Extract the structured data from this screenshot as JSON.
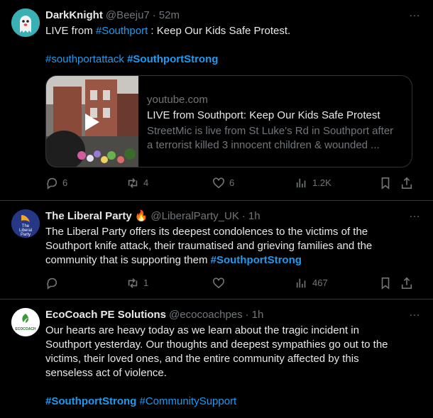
{
  "posts": [
    {
      "name": "DarkKnight",
      "handle": "@Beeju7",
      "dot": "·",
      "time": "52m",
      "text_pre": "LIVE from ",
      "text_link": "#Southport",
      "text_post": " : Keep Our Kids Safe Protest.",
      "hashtag1": "#southportattack",
      "hashtag2": "#SouthportStrong",
      "card": {
        "domain": "youtube.com",
        "title": "LIVE from Southport: Keep Our Kids Safe Protest",
        "desc_line1": "StreetMic is live from St Luke's Rd in Southport after",
        "desc_line2": "a terrorist killed 3 innocent children & wounded ..."
      },
      "replies": "6",
      "reposts": "4",
      "likes": "6",
      "views": "1.2K"
    },
    {
      "name": "The Liberal Party",
      "emoji": "🔥",
      "handle": "@LiberalParty_UK",
      "dot": "·",
      "time": "1h",
      "avatar_text": "The Liberal Party",
      "line1": "The Liberal Party offers its deepest condolences to the victims of the",
      "line2": "Southport knife attack, their traumatised and grieving families and the",
      "line3_pre": "community that is supporting them ",
      "line3_tag": "#SouthportStrong",
      "replies": "",
      "reposts": "1",
      "likes": "",
      "views": "467"
    },
    {
      "name": "EcoCoach PE Solutions",
      "handle": "@ecocoachpes",
      "dot": "·",
      "time": "1h",
      "avatar_text": "ECOCOACH",
      "line1": "Our hearts are heavy today as we learn about the tragic incident in",
      "line2": "Southport yesterday. Our thoughts and deepest sympathies go out to the",
      "line3": "victims, their loved ones, and the entire community affected by this",
      "line4": "senseless act of violence.",
      "hashtag1": "#SouthportStrong",
      "hashtag2": "#CommunitySupport"
    }
  ],
  "more_label": "···"
}
